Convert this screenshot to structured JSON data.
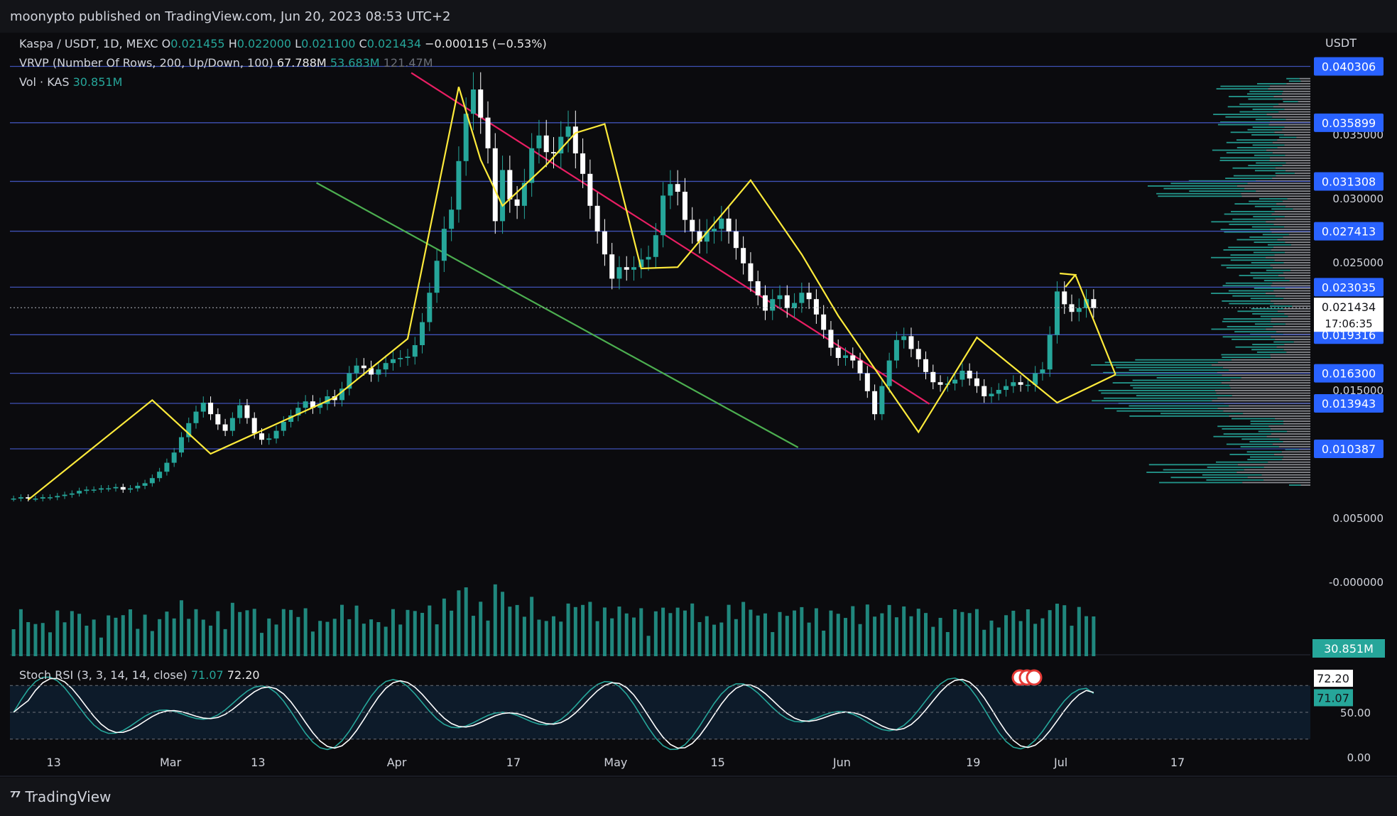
{
  "header": {
    "published": "moonypto published on TradingView.com, Jun 20, 2023 08:53 UTC+2"
  },
  "footer": {
    "brand": "TradingView"
  },
  "legend": {
    "symbol": "Kaspa / USDT, 1D, MEXC",
    "o_label": "O",
    "o": "0.021455",
    "h_label": "H",
    "h": "0.022000",
    "l_label": "L",
    "l": "0.021100",
    "c_label": "C",
    "c": "0.021434",
    "change": "−0.000115 (−0.53%)",
    "vrvp_label": "VRVP (Number Of Rows, 200, Up/Down, 100)",
    "vrvp_v1": "67.788M",
    "vrvp_v2": "53.683M",
    "vrvp_v3": "121.47M",
    "vol_label": "Vol · KAS",
    "vol_value": "30.851M",
    "stoch_label": "Stoch RSI (3, 3, 14, 14, close)",
    "stoch_k": "71.07",
    "stoch_d": "72.20"
  },
  "colors": {
    "up": "#26a69a",
    "down": "#ffffff",
    "hline": "#3f51b5",
    "trend_red": "#e91e63",
    "trend_green": "#4caf50",
    "zigzag": "#ffeb3b",
    "tag_bg": "#2962ff"
  },
  "chart_data": {
    "type": "candlestick",
    "symbol": "Kaspa / USDT",
    "timeframe": "1D",
    "exchange": "MEXC",
    "y_unit": "USDT",
    "ylim": [
      -0.0055,
      0.0425
    ],
    "y_ticks": [
      0.0,
      0.005,
      0.015,
      0.025,
      0.03,
      0.035
    ],
    "y_tick_labels": [
      "-0.000000",
      "0.005000",
      "0.015000",
      "0.025000",
      "0.030000",
      "0.035000"
    ],
    "x_labels": [
      "13",
      "Mar",
      "13",
      "Apr",
      "17",
      "May",
      "15",
      "Jun",
      "19",
      "Jul",
      "17"
    ],
    "x_label_dates": [
      "2023-02-13",
      "2023-03-01",
      "2023-03-13",
      "2023-04-01",
      "2023-04-17",
      "2023-05-01",
      "2023-05-15",
      "2023-06-01",
      "2023-06-19",
      "2023-07-01",
      "2023-07-17"
    ],
    "current_price": {
      "value": 0.021434,
      "label": "0.021434",
      "countdown": "17:06:35"
    },
    "levels": [
      {
        "value": 0.040306,
        "label": "0.040306"
      },
      {
        "value": 0.035899,
        "label": "0.035899"
      },
      {
        "value": 0.031308,
        "label": "0.031308"
      },
      {
        "value": 0.027413,
        "label": "0.027413"
      },
      {
        "value": 0.023035,
        "label": "0.023035"
      },
      {
        "value": 0.019316,
        "label": "0.019316"
      },
      {
        "value": 0.0163,
        "label": "0.016300"
      },
      {
        "value": 0.013943,
        "label": "0.013943"
      },
      {
        "value": 0.010387,
        "label": "0.010387"
      }
    ],
    "candles_close": [
      0.0065,
      0.0066,
      0.0065,
      0.0065,
      0.0066,
      0.0066,
      0.0067,
      0.0068,
      0.0069,
      0.0071,
      0.0072,
      0.0072,
      0.0073,
      0.0073,
      0.0074,
      0.0072,
      0.0073,
      0.0075,
      0.0077,
      0.0081,
      0.0086,
      0.0093,
      0.0101,
      0.0113,
      0.0124,
      0.0133,
      0.014,
      0.0131,
      0.0123,
      0.0118,
      0.0128,
      0.0138,
      0.0128,
      0.0116,
      0.0111,
      0.0112,
      0.0118,
      0.0125,
      0.013,
      0.0136,
      0.0141,
      0.0136,
      0.0139,
      0.0145,
      0.0142,
      0.0151,
      0.0163,
      0.0169,
      0.0167,
      0.0162,
      0.0166,
      0.0171,
      0.0174,
      0.0175,
      0.0176,
      0.0185,
      0.0203,
      0.0226,
      0.0251,
      0.0276,
      0.0291,
      0.0329,
      0.0366,
      0.0385,
      0.0363,
      0.0339,
      0.0282,
      0.0322,
      0.0299,
      0.0294,
      0.0312,
      0.0339,
      0.0349,
      0.0336,
      0.0335,
      0.0348,
      0.0356,
      0.0335,
      0.0319,
      0.0294,
      0.0274,
      0.0256,
      0.0237,
      0.0246,
      0.0244,
      0.0246,
      0.0252,
      0.0254,
      0.0271,
      0.0302,
      0.0311,
      0.0305,
      0.0283,
      0.0274,
      0.0266,
      0.0274,
      0.0276,
      0.0284,
      0.0274,
      0.0261,
      0.0249,
      0.0235,
      0.0224,
      0.0212,
      0.0221,
      0.0224,
      0.0214,
      0.0218,
      0.0226,
      0.0221,
      0.0209,
      0.0197,
      0.0183,
      0.0175,
      0.0177,
      0.0173,
      0.0163,
      0.0149,
      0.0131,
      0.0153,
      0.0173,
      0.0189,
      0.0192,
      0.0182,
      0.0174,
      0.0164,
      0.0156,
      0.0154,
      0.0155,
      0.0158,
      0.0165,
      0.0159,
      0.0153,
      0.0145,
      0.0147,
      0.015,
      0.0153,
      0.0156,
      0.0154,
      0.0154,
      0.0163,
      0.0166,
      0.0193,
      0.0227,
      0.0217,
      0.0211,
      0.0214,
      0.0221,
      0.0214
    ],
    "volume_unit": "KAS",
    "volume_last": "30.851M",
    "stoch_rsi": {
      "params": "3, 3, 14, 14, close",
      "k": 71.07,
      "d": 72.2,
      "ticks": [
        0,
        50
      ],
      "tick_labels": [
        "0.00",
        "50.00"
      ],
      "band": [
        20,
        80
      ]
    },
    "volume_profile": {
      "rows": 200,
      "values": [
        "67.788M",
        "53.683M",
        "121.47M"
      ]
    }
  }
}
